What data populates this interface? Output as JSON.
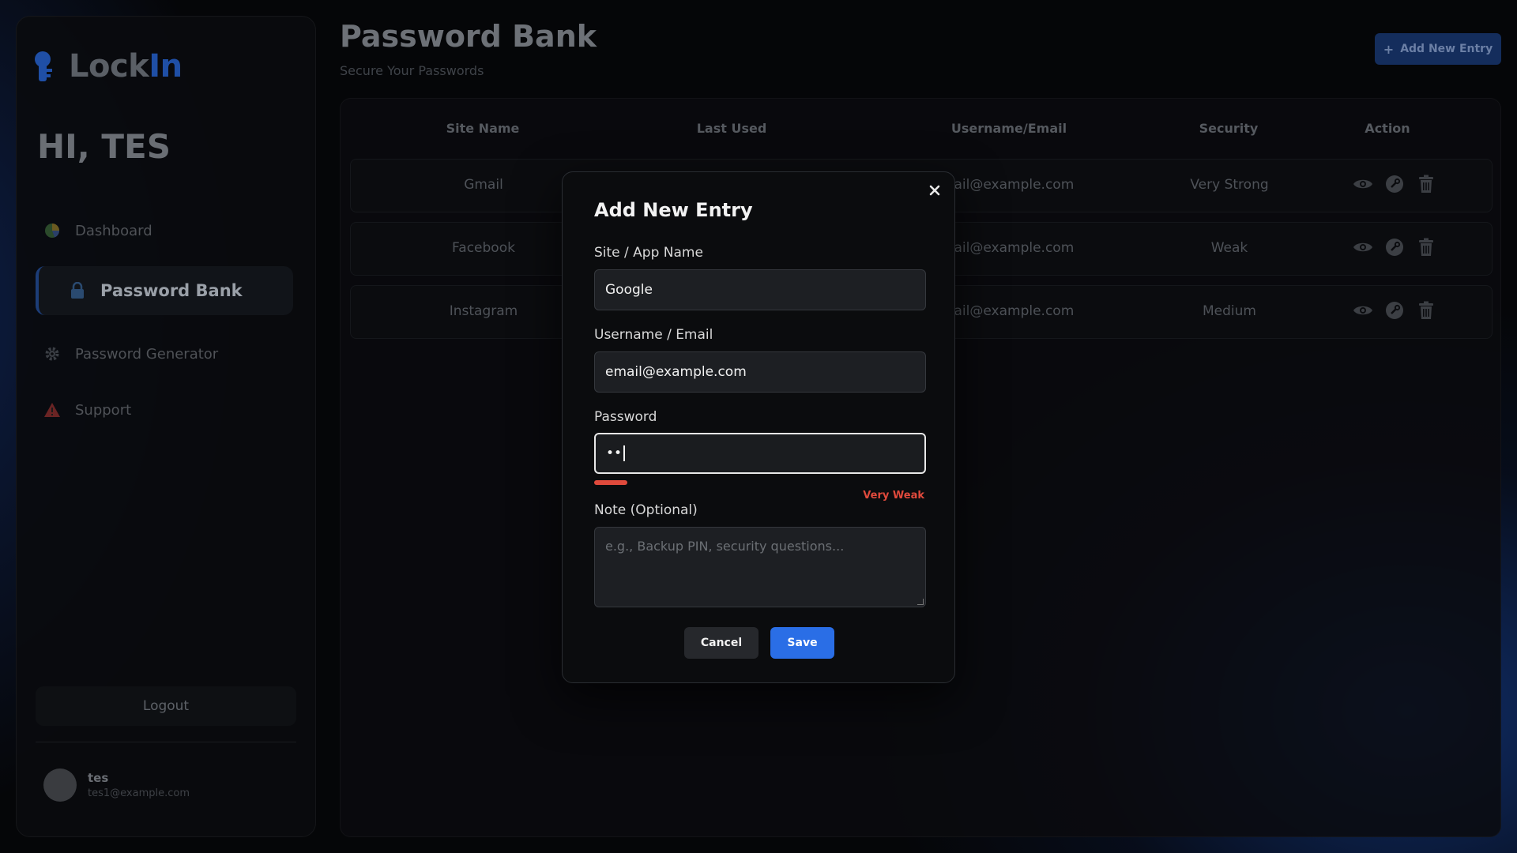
{
  "app": {
    "logo_prefix": "Lock",
    "logo_accent": "In",
    "greeting": "HI, TES",
    "accent_color": "#2a6ee6"
  },
  "sidebar": {
    "items": [
      {
        "label": "Dashboard",
        "icon": "pie-chart-icon"
      },
      {
        "label": "Password Bank",
        "icon": "lock-icon",
        "active": true
      },
      {
        "label": "Password Generator",
        "icon": "gear-icon"
      },
      {
        "label": "Support",
        "icon": "warning-icon"
      }
    ],
    "logout_label": "Logout",
    "user": {
      "name": "tes",
      "email": "tes1@example.com"
    }
  },
  "main": {
    "title": "Password Bank",
    "subtitle": "Secure Your Passwords",
    "add_button_label": "Add New Entry",
    "table": {
      "columns": [
        "Site Name",
        "Last Used",
        "Username/Email",
        "Security",
        "Action"
      ],
      "rows": [
        {
          "site": "Gmail",
          "username_visible": "nail@example.com",
          "security": "Very Strong"
        },
        {
          "site": "Facebook",
          "username_visible": "nail@example.com",
          "security": "Weak"
        },
        {
          "site": "Instagram",
          "username_visible": "nail@example.com",
          "security": "Medium"
        }
      ],
      "action_icons": [
        "eye-icon",
        "key-icon",
        "trash-icon"
      ]
    }
  },
  "modal": {
    "title": "Add New Entry",
    "site_label": "Site / App Name",
    "site_value": "Google",
    "username_label": "Username / Email",
    "username_value": "email@example.com",
    "password_label": "Password",
    "password_masked": "••",
    "strength_text": "Very Weak",
    "strength_fraction": 0.1,
    "strength_color": "#e04a3c",
    "note_label": "Note (Optional)",
    "note_placeholder": "e.g., Backup PIN, security questions...",
    "cancel_label": "Cancel",
    "save_label": "Save"
  }
}
